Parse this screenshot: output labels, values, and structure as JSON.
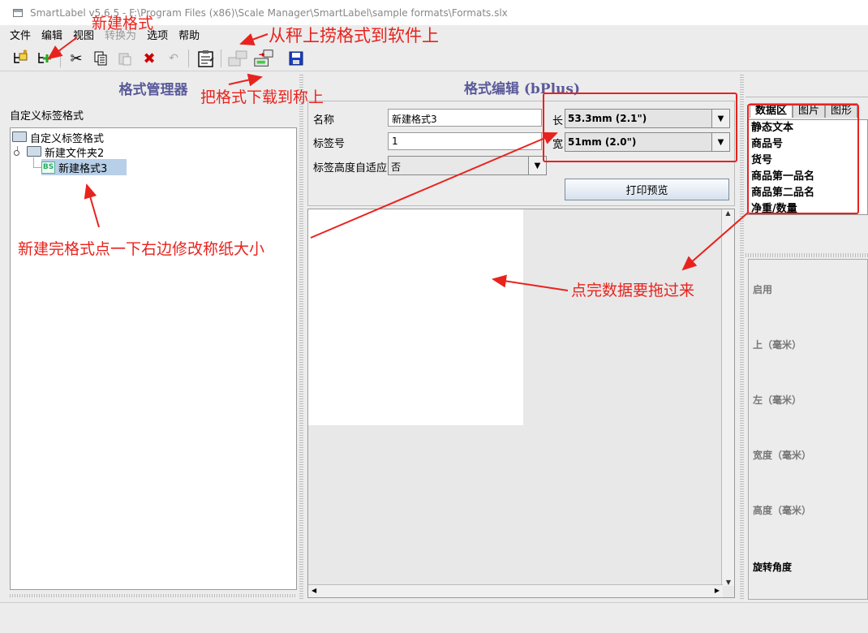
{
  "window": {
    "title": "SmartLabel v5.6.5 - F:\\Program Files (x86)\\Scale Manager\\SmartLabel\\sample formats\\Formats.slx"
  },
  "menu": [
    "文件",
    "编辑",
    "视图",
    "转换为",
    "选项",
    "帮助"
  ],
  "left_panel": {
    "header": "格式管理器",
    "subtitle": "自定义标签格式",
    "tree": {
      "root": "自定义标签格式",
      "folder": "新建文件夹2",
      "item": "新建格式3",
      "item_badge": "BS"
    }
  },
  "editor": {
    "header": "格式编辑 (bPlus)",
    "name_label": "名称",
    "name_value": "新建格式3",
    "label_no_label": "标签号",
    "label_no_value": "1",
    "auto_height_label": "标签高度自适应",
    "auto_height_value": "否",
    "length_label": "长",
    "length_value": "53.3mm (2.1\")",
    "width_label": "宽",
    "width_value": "51mm (2.0\")",
    "print_preview": "打印预览"
  },
  "right_panel": {
    "tabs": [
      "数据区",
      "图片",
      "图形"
    ],
    "data_items": [
      "静态文本",
      "商品号",
      "货号",
      "商品第一品名",
      "商品第二品名",
      "净重/数量"
    ],
    "properties": [
      "启用",
      "上（毫米）",
      "左（毫米）",
      "宽度（毫米）",
      "高度（毫米）",
      "旋转角度"
    ]
  },
  "annotations": {
    "new_format": "新建格式",
    "fetch_from_scale": "从秤上捞格式到软件上",
    "download_to_scale": "把格式下载到称上",
    "resize_hint": "新建完格式点一下右边修改称纸大小",
    "drag_hint": "点完数据要拖过来"
  },
  "colors": {
    "annotation": "#e8231e",
    "panel_header": "#5a5a9a",
    "selection": "#b8cfe8"
  }
}
